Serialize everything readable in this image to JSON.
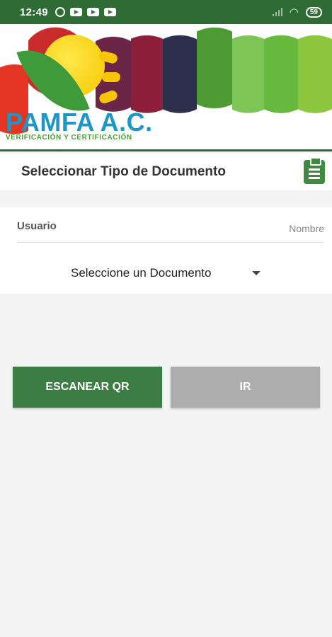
{
  "status_bar": {
    "time": "12:49",
    "battery": "59",
    "icons": [
      "alarm-icon",
      "youtube-icon",
      "youtube-icon",
      "youtube-icon",
      "signal-icon",
      "wifi-icon",
      "battery-icon"
    ]
  },
  "banner": {
    "logo_title": "PAMFA A.C.",
    "logo_subtitle": "VERIFICACIÓN Y CERTIFICACIÓN"
  },
  "header": {
    "title": "Seleccionar Tipo de Documento",
    "icon": "clipboard-icon"
  },
  "form": {
    "user_label": "Usuario",
    "user_placeholder": "Nombre",
    "document_select": "Seleccione un Documento"
  },
  "actions": {
    "scan_label": "ESCANEAR QR",
    "go_label": "IR"
  },
  "colors": {
    "primary": "#3c7d43",
    "status_bar": "#2f6b35",
    "disabled": "#adadad",
    "background": "#f4f4f4"
  }
}
